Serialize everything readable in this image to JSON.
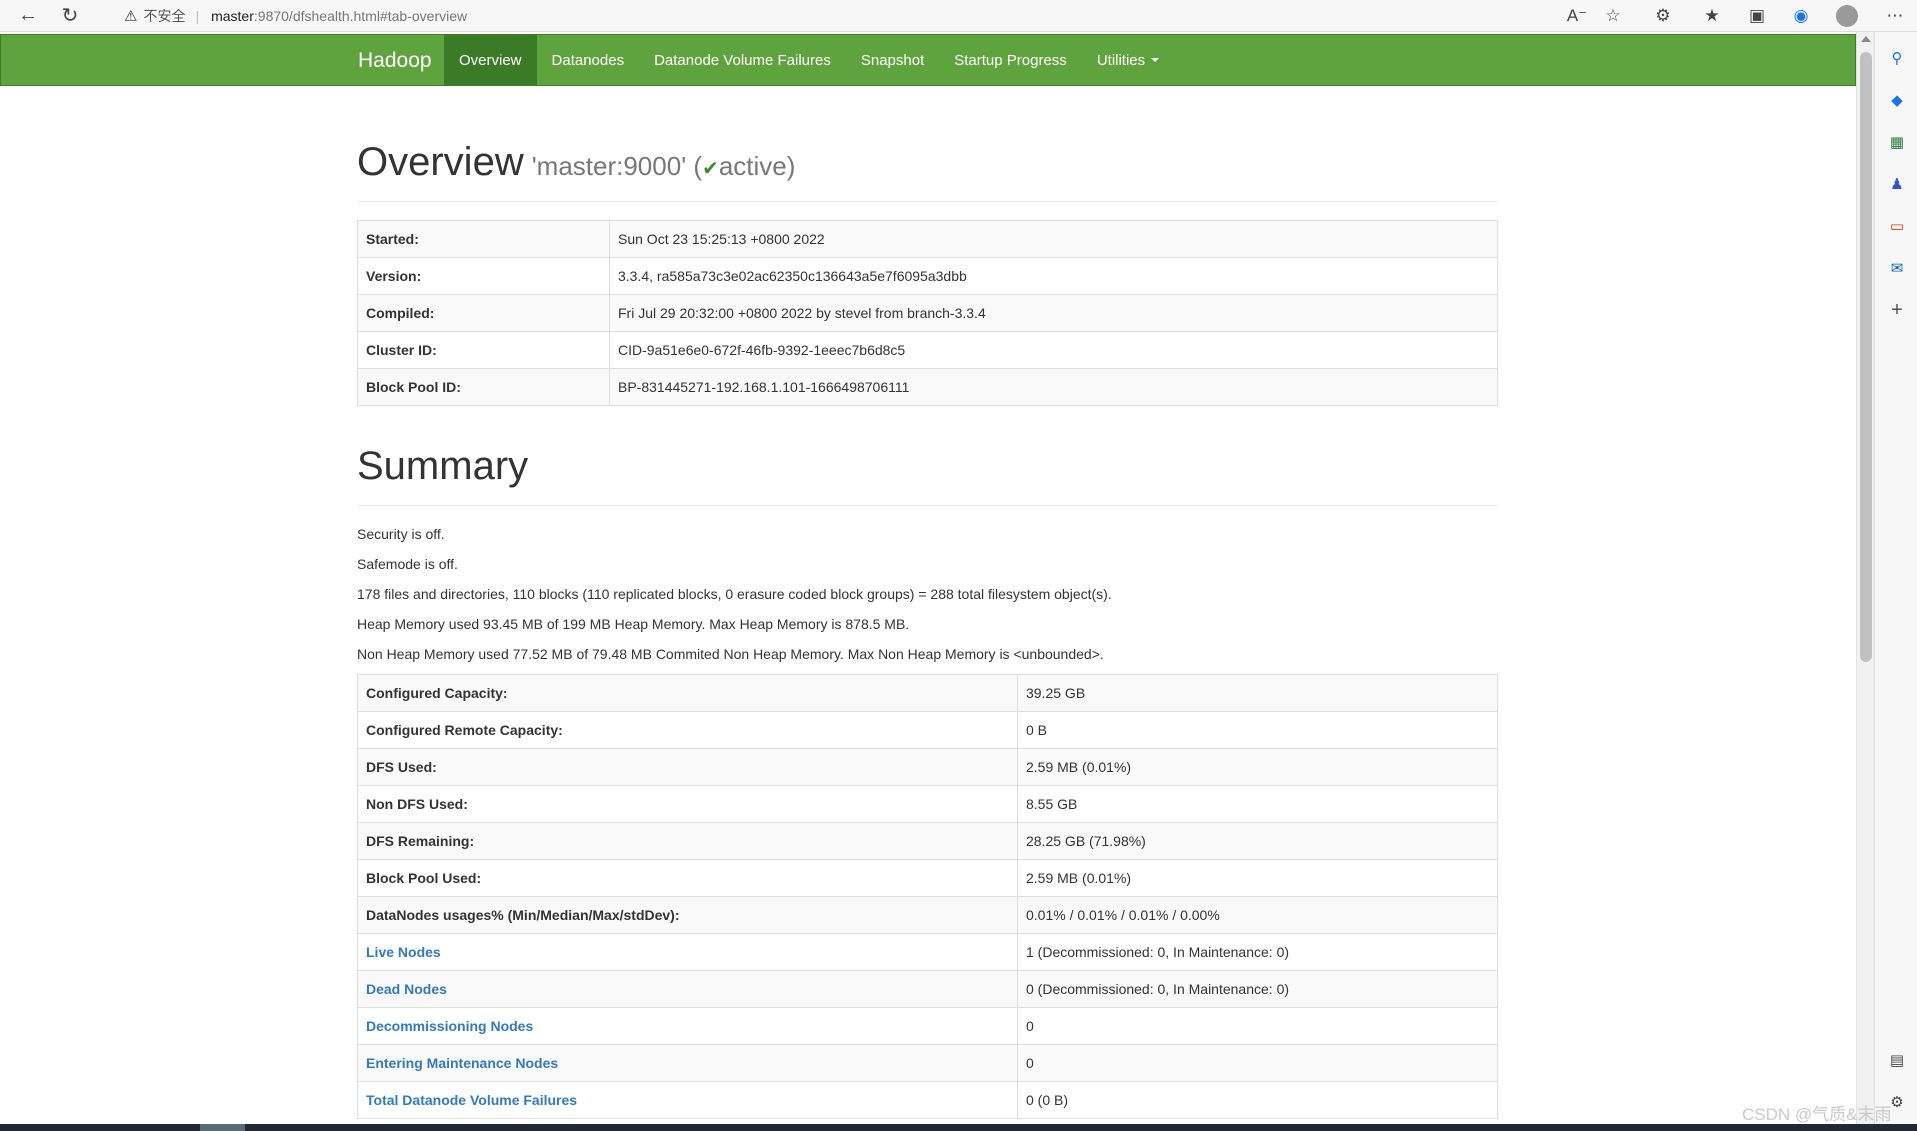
{
  "browser": {
    "insecure_label": "不安全",
    "url_host": "master",
    "url_rest": ":9870/dfshealth.html#tab-overview"
  },
  "navbar": {
    "brand": "Hadoop",
    "items": [
      {
        "label": "Overview",
        "active": true
      },
      {
        "label": "Datanodes"
      },
      {
        "label": "Datanode Volume Failures"
      },
      {
        "label": "Snapshot"
      },
      {
        "label": "Startup Progress"
      },
      {
        "label": "Utilities",
        "dropdown": true
      }
    ],
    "bg_color": "#5fa33e",
    "active_color": "#3b7a27"
  },
  "overview": {
    "title": "Overview",
    "namenode": "'master:9000'",
    "status_open": "(",
    "status": "active)",
    "rows": [
      {
        "key": "Started:",
        "value": "Sun Oct 23 15:25:13 +0800 2022"
      },
      {
        "key": "Version:",
        "value": "3.3.4, ra585a73c3e02ac62350c136643a5e7f6095a3dbb"
      },
      {
        "key": "Compiled:",
        "value": "Fri Jul 29 20:32:00 +0800 2022 by stevel from branch-3.3.4"
      },
      {
        "key": "Cluster ID:",
        "value": "CID-9a51e6e0-672f-46fb-9392-1eeec7b6d8c5"
      },
      {
        "key": "Block Pool ID:",
        "value": "BP-831445271-192.168.1.101-1666498706111"
      }
    ]
  },
  "summary": {
    "title": "Summary",
    "lines": [
      "Security is off.",
      "Safemode is off.",
      "178 files and directories, 110 blocks (110 replicated blocks, 0 erasure coded block groups) = 288 total filesystem object(s).",
      "Heap Memory used 93.45 MB of 199 MB Heap Memory. Max Heap Memory is 878.5 MB.",
      "Non Heap Memory used 77.52 MB of 79.48 MB Commited Non Heap Memory. Max Non Heap Memory is <unbounded>."
    ],
    "rows": [
      {
        "key": "Configured Capacity:",
        "value": "39.25 GB"
      },
      {
        "key": "Configured Remote Capacity:",
        "value": "0 B"
      },
      {
        "key": "DFS Used:",
        "value": "2.59 MB (0.01%)"
      },
      {
        "key": "Non DFS Used:",
        "value": "8.55 GB"
      },
      {
        "key": "DFS Remaining:",
        "value": "28.25 GB (71.98%)"
      },
      {
        "key": "Block Pool Used:",
        "value": "2.59 MB (0.01%)"
      },
      {
        "key": "DataNodes usages% (Min/Median/Max/stdDev):",
        "value": "0.01% / 0.01% / 0.01% / 0.00%"
      },
      {
        "key": "Live Nodes",
        "value": "1 (Decommissioned: 0, In Maintenance: 0)",
        "link": true
      },
      {
        "key": "Dead Nodes",
        "value": "0 (Decommissioned: 0, In Maintenance: 0)",
        "link": true
      },
      {
        "key": "Decommissioning Nodes",
        "value": "0",
        "link": true
      },
      {
        "key": "Entering Maintenance Nodes",
        "value": "0",
        "link": true
      },
      {
        "key": "Total Datanode Volume Failures",
        "value": "0 (0 B)",
        "link": true
      }
    ]
  },
  "watermark": "CSDN @气质&末雨"
}
